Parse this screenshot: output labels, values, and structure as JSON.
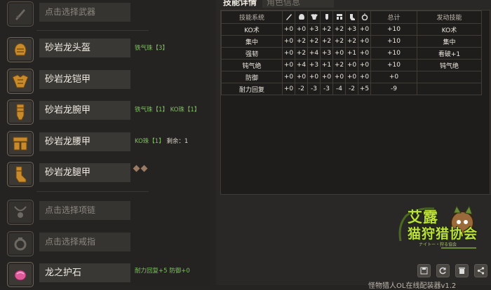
{
  "equipment": [
    {
      "name": "点击选择武器",
      "placeholder": true,
      "deco": ""
    },
    {
      "name": "砂岩龙头盔",
      "placeholder": false,
      "deco": "铁气珠【3】"
    },
    {
      "name": "砂岩龙铠甲",
      "placeholder": false,
      "deco": ""
    },
    {
      "name": "砂岩龙腕甲",
      "placeholder": false,
      "deco": "铁气珠【1】 KO珠【1】"
    },
    {
      "name": "砂岩龙腰甲",
      "placeholder": false,
      "deco": "KO珠【1】",
      "extra": "剩余：1"
    },
    {
      "name": "砂岩龙腿甲",
      "placeholder": false,
      "deco": ""
    },
    {
      "name": "点击选择项链",
      "placeholder": true,
      "deco": ""
    },
    {
      "name": "点击选择戒指",
      "placeholder": true,
      "deco": ""
    },
    {
      "name": "龙之护石",
      "placeholder": false,
      "deco": "耐力回复+5 防御+0"
    }
  ],
  "tabs": {
    "skills": "技能详情",
    "character": "角色信息"
  },
  "table": {
    "headers": {
      "skill": "技能系统",
      "total": "总计",
      "active": "发动技能"
    },
    "slot_icons": [
      "weapon-icon",
      "helm-icon",
      "chest-icon",
      "arm-icon",
      "waist-icon",
      "leg-icon",
      "charm-icon"
    ],
    "rows": [
      {
        "skill": "KO术",
        "vals": [
          "+0",
          "+0",
          "+3",
          "+2",
          "+2",
          "+3",
          "+0"
        ],
        "total": "+10",
        "active": "KO术"
      },
      {
        "skill": "集中",
        "vals": [
          "+0",
          "+2",
          "+2",
          "+2",
          "+2",
          "+2",
          "+0"
        ],
        "total": "+10",
        "active": "集中"
      },
      {
        "skill": "强韧",
        "vals": [
          "+0",
          "+2",
          "+4",
          "+3",
          "+0",
          "+1",
          "+0"
        ],
        "total": "+10",
        "active": "看破+1"
      },
      {
        "skill": "钝气绝",
        "vals": [
          "+0",
          "+4",
          "+3",
          "+1",
          "+2",
          "+0",
          "+0"
        ],
        "total": "+10",
        "active": "钝气绝"
      },
      {
        "skill": "防御",
        "vals": [
          "+0",
          "+0",
          "+0",
          "+0",
          "+0",
          "+0",
          "+0"
        ],
        "total": "+0",
        "active": ""
      },
      {
        "skill": "耐力回复",
        "vals": [
          "+0",
          "-2",
          "-3",
          "-3",
          "-4",
          "-2",
          "+5"
        ],
        "total": "-9",
        "active": ""
      }
    ]
  },
  "logo": {
    "line1": "艾露",
    "line2": "猫狩猎协会",
    "sub": "ナイトー・狩る協会"
  },
  "bottom_text": "怪物猎人OL在线配装器v1.2",
  "colors": {
    "deco_green": "#7fbf62",
    "logo_green": "#bfe03a"
  }
}
